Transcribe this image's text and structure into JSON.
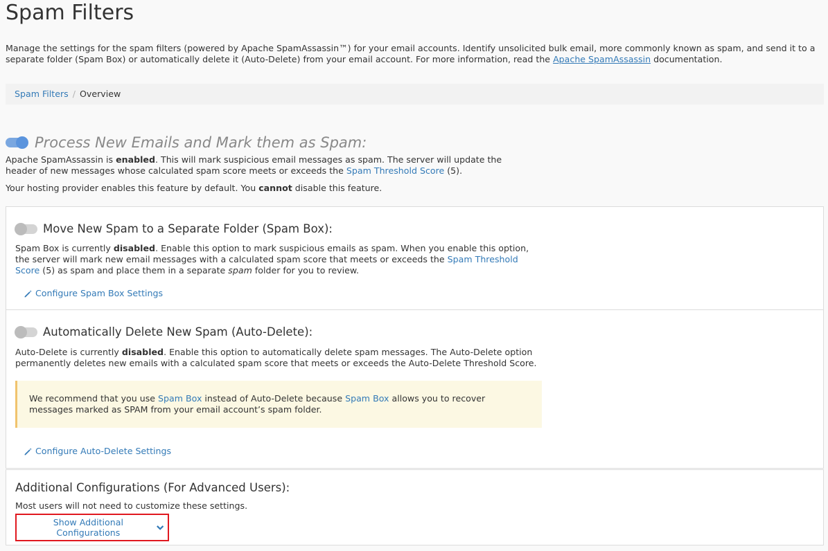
{
  "page": {
    "title": "Spam Filters",
    "intro_before": "Manage the settings for the spam filters (powered by Apache SpamAssassin™) for your email accounts. Identify unsolicited bulk email, more commonly known as spam, and send it to a separate folder (Spam Box) or automatically delete it (Auto-Delete) from your email account. For more information, read the ",
    "intro_link": "Apache SpamAssassin",
    "intro_after": " documentation."
  },
  "breadcrumb": {
    "parent": "Spam Filters",
    "separator": "/",
    "current": "Overview"
  },
  "process_section": {
    "toggle_state": "on",
    "heading": "Process New Emails and Mark them as Spam:",
    "desc_1": "Apache SpamAssassin is ",
    "desc_bold": "enabled",
    "desc_2": ". This will mark suspicious email messages as spam. The server will update the header of new messages whose calculated spam score meets or exceeds the ",
    "desc_link": "Spam Threshold Score",
    "desc_3": " (5).",
    "note_1": "Your hosting provider enables this feature by default. You ",
    "note_bold": "cannot",
    "note_2": " disable this feature."
  },
  "spam_box": {
    "toggle_state": "off",
    "heading": "Move New Spam to a Separate Folder (Spam Box):",
    "desc_1": "Spam Box is currently ",
    "desc_bold": "disabled",
    "desc_2": ". Enable this option to mark suspicious emails as spam. When you enable this option, the server will mark new email messages with a calculated spam score that meets or exceeds the ",
    "desc_link": "Spam Threshold Score",
    "desc_3": " (5) as spam and place them in a separate ",
    "desc_italic": "spam",
    "desc_4": " folder for you to review.",
    "config_link": "Configure Spam Box Settings"
  },
  "auto_delete": {
    "toggle_state": "off",
    "heading": "Automatically Delete New Spam (Auto-Delete):",
    "desc_1": "Auto-Delete is currently ",
    "desc_bold": "disabled",
    "desc_2": ". Enable this option to automatically delete spam messages. The Auto-Delete option permanently deletes new emails with a calculated spam score that meets or exceeds the Auto-Delete Threshold Score.",
    "alert_1": "We recommend that you use ",
    "alert_link_1": "Spam Box",
    "alert_2": " instead of Auto-Delete because ",
    "alert_link_2": "Spam Box",
    "alert_3": " allows you to recover messages marked as SPAM from your email account’s spam folder.",
    "config_link": "Configure Auto-Delete Settings"
  },
  "additional": {
    "heading": "Additional Configurations (For Advanced Users):",
    "note": "Most users will not need to customize these settings.",
    "show_button": "Show Additional Configurations"
  },
  "colors": {
    "link": "#337ab7",
    "toggle_on": "#5b94dd",
    "toggle_off": "#bcbcbc",
    "alert_bg": "#fcf8e3",
    "alert_border": "#f0c36d",
    "highlight_box": "#e0181f"
  },
  "icons": {
    "config_link_icon": "pencil-icon",
    "show_button_icon": "chevron-down-icon"
  }
}
